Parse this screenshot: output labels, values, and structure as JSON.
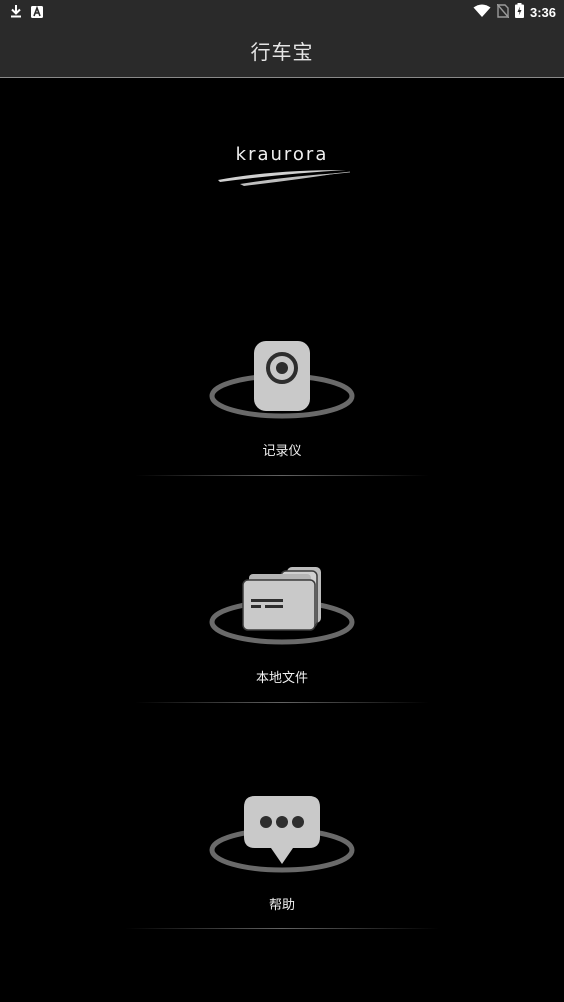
{
  "status_bar": {
    "time": "3:36",
    "left_icons": [
      "download-icon",
      "font-a-icon"
    ],
    "right_icons": [
      "wifi-icon",
      "no-sim-icon",
      "battery-charging-icon"
    ]
  },
  "app_bar": {
    "title": "行车宝"
  },
  "logo": {
    "text": "kraurora"
  },
  "menu": [
    {
      "label": "记录仪",
      "icon": "camera-recorder-icon"
    },
    {
      "label": "本地文件",
      "icon": "folder-files-icon"
    },
    {
      "label": "帮助",
      "icon": "chat-bubble-icon"
    }
  ],
  "colors": {
    "background": "#000000",
    "bar": "#2a2a2a",
    "icon_gray": "#c9c9c9",
    "ring_gray": "#6a6a6a"
  }
}
